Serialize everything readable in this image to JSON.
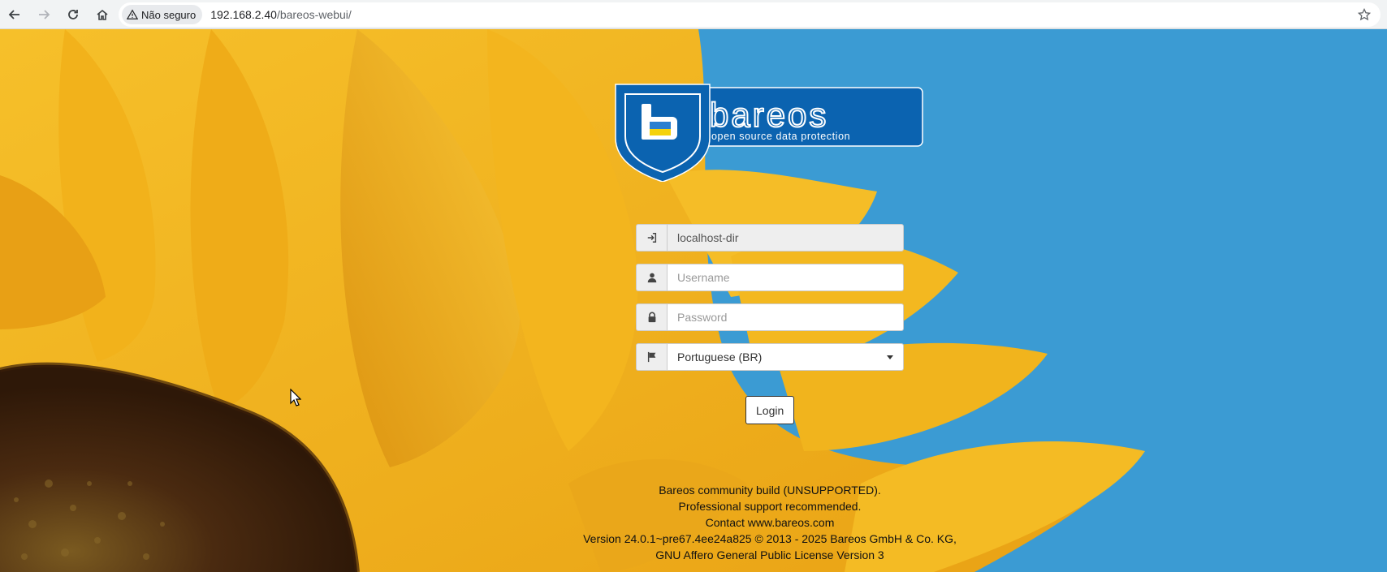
{
  "browser": {
    "security_label": "Não seguro",
    "url_host": "192.168.2.40",
    "url_path": "/bareos-webui/",
    "icons": [
      "back-icon",
      "forward-icon",
      "reload-icon",
      "home-icon",
      "warning-icon",
      "star-icon"
    ]
  },
  "logo": {
    "brand": "bareos",
    "tagline": "open source data protection",
    "colors": {
      "shield": "#0b63b0",
      "accent_yellow": "#f5d20a",
      "accent_blue": "#2a7fd0"
    }
  },
  "login": {
    "director_value": "localhost-dir",
    "username_placeholder": "Username",
    "password_placeholder": "Password",
    "language_selected": "Portuguese (BR)",
    "submit_label": "Login",
    "icons": [
      "sign-in-icon",
      "user-icon",
      "lock-icon",
      "flag-icon",
      "caret-down-icon"
    ]
  },
  "footer": {
    "line1": "Bareos community build (UNSUPPORTED).",
    "line2": "Professional support recommended.",
    "line3": "Contact www.bareos.com",
    "line4": "Version 24.0.1~pre67.4ee24a825 © 2013 - 2025 Bareos GmbH & Co. KG,",
    "line5": "GNU Affero General Public License Version 3"
  },
  "colors": {
    "sky": "#3b9bd3",
    "petal": "#f3b21c",
    "petal_dark": "#d98e0c",
    "seed": "#4a2a10"
  }
}
